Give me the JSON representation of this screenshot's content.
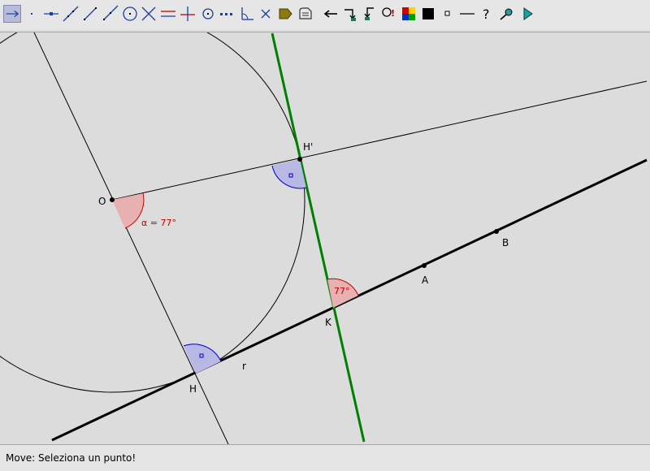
{
  "toolbar": {
    "tools": [
      {
        "id": "move",
        "icon": "move-arrow-icon",
        "active": true
      },
      {
        "id": "point",
        "icon": "point-icon"
      },
      {
        "id": "point-on-object",
        "icon": "point-on-line-icon"
      },
      {
        "id": "line",
        "icon": "line-through-points-icon"
      },
      {
        "id": "segment",
        "icon": "segment-icon"
      },
      {
        "id": "ray",
        "icon": "ray-icon"
      },
      {
        "id": "circle",
        "icon": "circle-icon"
      },
      {
        "id": "intersect",
        "icon": "intersect-icon"
      },
      {
        "id": "parallel",
        "icon": "parallel-line-icon"
      },
      {
        "id": "perpendicular",
        "icon": "perpendicular-line-icon"
      },
      {
        "id": "midpoint",
        "icon": "midpoint-icon"
      },
      {
        "id": "dashed-line",
        "icon": "dashed-line-icon"
      },
      {
        "id": "angle-tool",
        "icon": "angle-icon"
      },
      {
        "id": "delete",
        "icon": "delete-x-icon"
      },
      {
        "id": "label",
        "icon": "label-tag-icon"
      },
      {
        "id": "measure",
        "icon": "measure-icon"
      },
      {
        "id": "undo",
        "icon": "arrow-left-icon"
      },
      {
        "id": "redo",
        "icon": "redo-icon"
      },
      {
        "id": "redo-all",
        "icon": "redo-all-icon"
      },
      {
        "id": "inspect",
        "icon": "inspect-icon"
      },
      {
        "id": "colors",
        "icon": "color-palette-icon"
      },
      {
        "id": "fill",
        "icon": "fill-square-icon"
      },
      {
        "id": "point-style",
        "icon": "small-square-icon"
      },
      {
        "id": "line-style",
        "icon": "line-style-icon"
      },
      {
        "id": "help",
        "icon": "help-icon"
      },
      {
        "id": "zoom",
        "icon": "zoom-icon"
      },
      {
        "id": "play",
        "icon": "play-icon"
      }
    ]
  },
  "canvas": {
    "labels": {
      "O": "O",
      "H_prime": "H'",
      "H": "H",
      "K": "K",
      "A": "A",
      "B": "B",
      "r": "r",
      "alpha": "α = 77°",
      "angle_k": "77°"
    },
    "colors": {
      "green_line": "#008000",
      "red_angle_fill": "#e8a8a8",
      "red_angle_stroke": "#c00000",
      "blue_angle_fill": "#b0b0e0",
      "blue_angle_stroke": "#0000cc",
      "background": "#dcdcdc"
    }
  },
  "status": {
    "text": "Move: Seleziona un punto!"
  }
}
